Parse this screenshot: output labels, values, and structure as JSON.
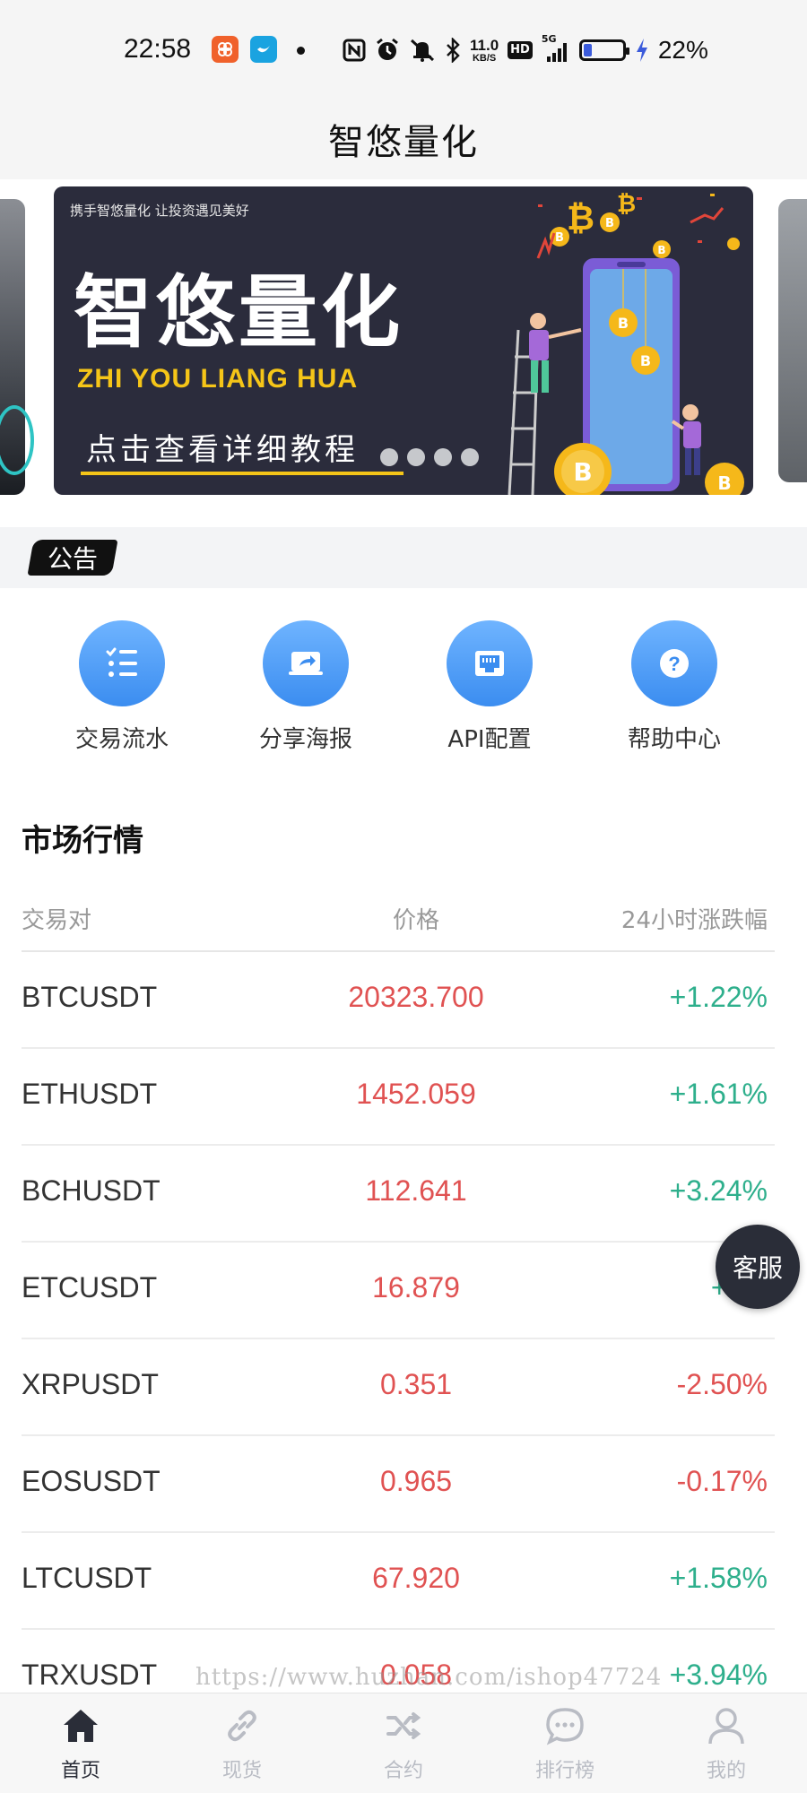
{
  "status_bar": {
    "time": "22:58",
    "net_speed_value": "11.0",
    "net_speed_unit": "KB/S",
    "hd_label": "HD",
    "signal_label": "5G",
    "battery_percent": "22%",
    "battery_level": 0.22
  },
  "header": {
    "title": "智悠量化"
  },
  "banner": {
    "tagline": "携手智悠量化 让投资遇见美好",
    "brand": "智悠量化",
    "pinyin": "ZHI YOU LIANG HUA",
    "cta": "点击查看详细教程",
    "slide_count": 4
  },
  "notice": {
    "tag": "公告"
  },
  "quick_menu": [
    {
      "label": "交易流水",
      "icon": "list-icon"
    },
    {
      "label": "分享海报",
      "icon": "share-icon"
    },
    {
      "label": "API配置",
      "icon": "api-icon"
    },
    {
      "label": "帮助中心",
      "icon": "help-icon"
    }
  ],
  "market": {
    "title": "市场行情",
    "columns": [
      "交易对",
      "价格",
      "24小时涨跌幅"
    ],
    "rows": [
      {
        "pair": "BTCUSDT",
        "price": "20323.700",
        "change": "+1.22%",
        "direction": "up"
      },
      {
        "pair": "ETHUSDT",
        "price": "1452.059",
        "change": "+1.61%",
        "direction": "up"
      },
      {
        "pair": "BCHUSDT",
        "price": "112.641",
        "change": "+3.24%",
        "direction": "up"
      },
      {
        "pair": "ETCUSDT",
        "price": "16.879",
        "change": "+0.9",
        "direction": "up"
      },
      {
        "pair": "XRPUSDT",
        "price": "0.351",
        "change": "-2.50%",
        "direction": "down"
      },
      {
        "pair": "EOSUSDT",
        "price": "0.965",
        "change": "-0.17%",
        "direction": "down"
      },
      {
        "pair": "LTCUSDT",
        "price": "67.920",
        "change": "+1.58%",
        "direction": "up"
      },
      {
        "pair": "TRXUSDT",
        "price": "0.058",
        "change": "+3.94%",
        "direction": "up"
      }
    ]
  },
  "service_button": {
    "label": "客服"
  },
  "watermark": "https://www.huzhan.com/ishop47724",
  "bottom_nav": [
    {
      "label": "首页",
      "icon": "home-icon",
      "active": true
    },
    {
      "label": "现货",
      "icon": "link-icon",
      "active": false
    },
    {
      "label": "合约",
      "icon": "shuffle-icon",
      "active": false
    },
    {
      "label": "排行榜",
      "icon": "chat-icon",
      "active": false
    },
    {
      "label": "我的",
      "icon": "user-icon",
      "active": false
    }
  ],
  "colors": {
    "up": "#2eaf8c",
    "down": "#e05252",
    "price": "#e05252",
    "accent_blue": "#3b8df0",
    "nav_active": "#2a2d38",
    "nav_inactive": "#b9bcc4",
    "banner_bg": "#2b2c3c",
    "banner_gold": "#f5c518"
  }
}
